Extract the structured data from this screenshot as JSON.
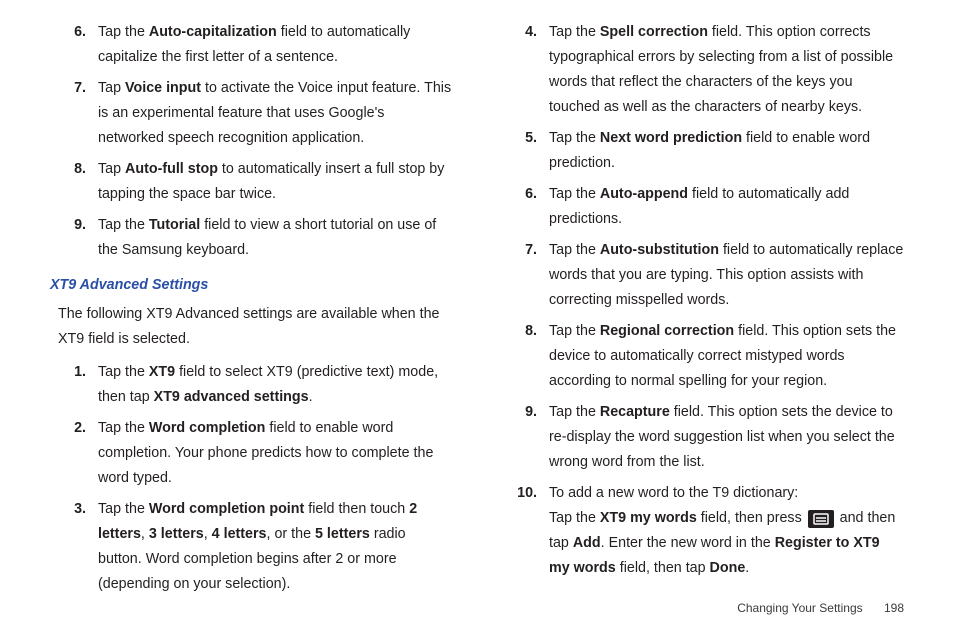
{
  "left": {
    "items_a": [
      {
        "n": "6.",
        "pre": "Tap the ",
        "b1": "Auto-capitalization",
        "post1": " field to automatically capitalize the first letter of a sentence."
      },
      {
        "n": "7.",
        "pre": "Tap ",
        "b1": "Voice input",
        "post1": " to activate the Voice input feature. This is an experimental feature that uses Google's networked speech recognition application."
      },
      {
        "n": "8.",
        "pre": "Tap ",
        "b1": "Auto-full stop",
        "post1": " to automatically insert a full stop by tapping the space bar twice."
      },
      {
        "n": "9.",
        "pre": "Tap the ",
        "b1": "Tutorial",
        "post1": " field to view a short tutorial on use of the Samsung keyboard."
      }
    ],
    "heading": "XT9 Advanced Settings",
    "intro": "The following XT9 Advanced settings are available when the XT9 field is selected.",
    "items_b": [
      {
        "n": "1.",
        "pre": "Tap the ",
        "b1": "XT9",
        "mid1": " field to select XT9 (predictive text) mode, then tap ",
        "b2": "XT9 advanced settings",
        "post": "."
      },
      {
        "n": "2.",
        "pre": "Tap the ",
        "b1": "Word completion",
        "post1": " field to enable word completion. Your phone predicts how to complete the word typed."
      },
      {
        "n": "3.",
        "pre": "Tap the ",
        "b1": "Word completion point",
        "mid1": " field then touch ",
        "b2": "2 letters",
        "c1": ", ",
        "b3": "3 letters",
        "c2": ", ",
        "b4": "4 letters",
        "c3": ", or the ",
        "b5": "5 letters",
        "post": " radio button. Word completion begins after 2 or more (depending on your selection)."
      }
    ]
  },
  "right": {
    "items": [
      {
        "n": "4.",
        "pre": "Tap the ",
        "b1": "Spell correction",
        "post1": " field. This option corrects typographical errors by selecting from a list of possible words that reflect the characters of the keys you touched as well as the characters of nearby keys."
      },
      {
        "n": "5.",
        "pre": "Tap the ",
        "b1": "Next word prediction",
        "post1": " field to enable word prediction."
      },
      {
        "n": "6.",
        "pre": "Tap the ",
        "b1": "Auto-append",
        "post1": " field to automatically add predictions."
      },
      {
        "n": "7.",
        "pre": "Tap the ",
        "b1": "Auto-substitution",
        "post1": " field to automatically replace words that you are typing. This option assists with correcting misspelled words."
      },
      {
        "n": "8.",
        "pre": "Tap the ",
        "b1": "Regional correction",
        "post1": " field. This option sets the device to automatically correct mistyped words according to normal spelling for your region."
      },
      {
        "n": "9.",
        "pre": "Tap the ",
        "b1": "Recapture",
        "post1": " field. This option sets the device to re-display the word suggestion list when you select the wrong word from the list."
      }
    ],
    "item10": {
      "n": "10.",
      "line1": "To add a new word to the T9 dictionary:",
      "l2_pre": "Tap the ",
      "l2_b1": "XT9 my words",
      "l2_mid1": " field, then press ",
      "l2_mid2": " and then tap ",
      "l2_b2": "Add",
      "l2_mid3": ". Enter the new word in the ",
      "l2_b3": "Register to XT9 my words",
      "l2_mid4": " field, then tap ",
      "l2_b4": "Done",
      "l2_end": "."
    }
  },
  "footer": {
    "section": "Changing Your Settings",
    "page": "198"
  }
}
